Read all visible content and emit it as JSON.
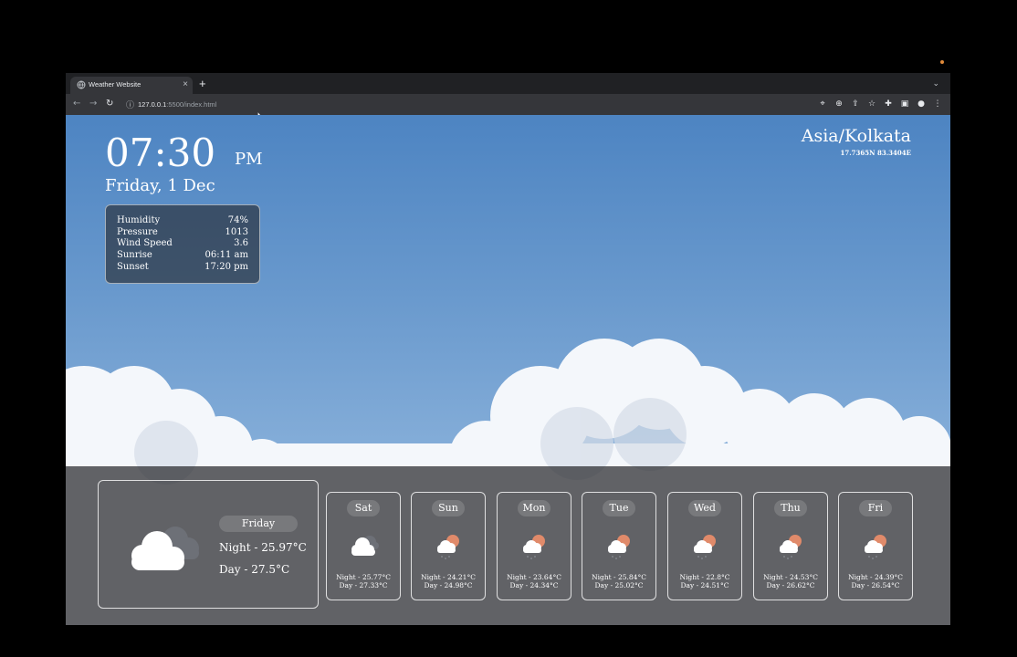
{
  "browser": {
    "tab_title": "Weather Website",
    "tab_close": "×",
    "new_tab": "+",
    "url_host": "127.0.0.1",
    "url_rest": ":5500/index.html",
    "icons": [
      "globe-icon",
      "back-icon",
      "forward-icon",
      "reload-icon",
      "info-icon",
      "location-icon",
      "zoom-icon",
      "share-icon",
      "star-icon",
      "extensions-icon",
      "sidepanel-icon",
      "profile-icon",
      "menu-icon"
    ]
  },
  "current": {
    "time": "07:30",
    "ampm": "PM",
    "date": "Friday, 1 Dec",
    "details": [
      {
        "label": "Humidity",
        "value": "74%"
      },
      {
        "label": "Pressure",
        "value": "1013"
      },
      {
        "label": "Wind Speed",
        "value": "3.6"
      },
      {
        "label": "Sunrise",
        "value": "06:11 am"
      },
      {
        "label": "Sunset",
        "value": "17:20 pm"
      }
    ],
    "timezone": "Asia/Kolkata",
    "coords": "17.7365N 83.3404E"
  },
  "today": {
    "day": "Friday",
    "night": "Night - 25.97°C",
    "day_temp": "Day - 27.5°C",
    "icon": "cloudy-icon"
  },
  "forecast": [
    {
      "day": "Sat",
      "night": "Night - 25.77°C",
      "day_temp": "Day - 27.33°C",
      "icon": "cloud-icon"
    },
    {
      "day": "Sun",
      "night": "Night - 24.21°C",
      "day_temp": "Day - 24.98°C",
      "icon": "sun-cloud-rain-icon"
    },
    {
      "day": "Mon",
      "night": "Night - 23.64°C",
      "day_temp": "Day - 24.34°C",
      "icon": "sun-cloud-rain-icon"
    },
    {
      "day": "Tue",
      "night": "Night - 25.84°C",
      "day_temp": "Day - 25.02°C",
      "icon": "sun-cloud-rain-icon"
    },
    {
      "day": "Wed",
      "night": "Night - 22.8°C",
      "day_temp": "Day - 24.51°C",
      "icon": "sun-cloud-rain-icon"
    },
    {
      "day": "Thu",
      "night": "Night - 24.53°C",
      "day_temp": "Day - 26.62°C",
      "icon": "sun-cloud-rain-icon"
    },
    {
      "day": "Fri",
      "night": "Night - 24.39°C",
      "day_temp": "Day - 26.54°C",
      "icon": "sun-cloud-rain-icon"
    }
  ]
}
